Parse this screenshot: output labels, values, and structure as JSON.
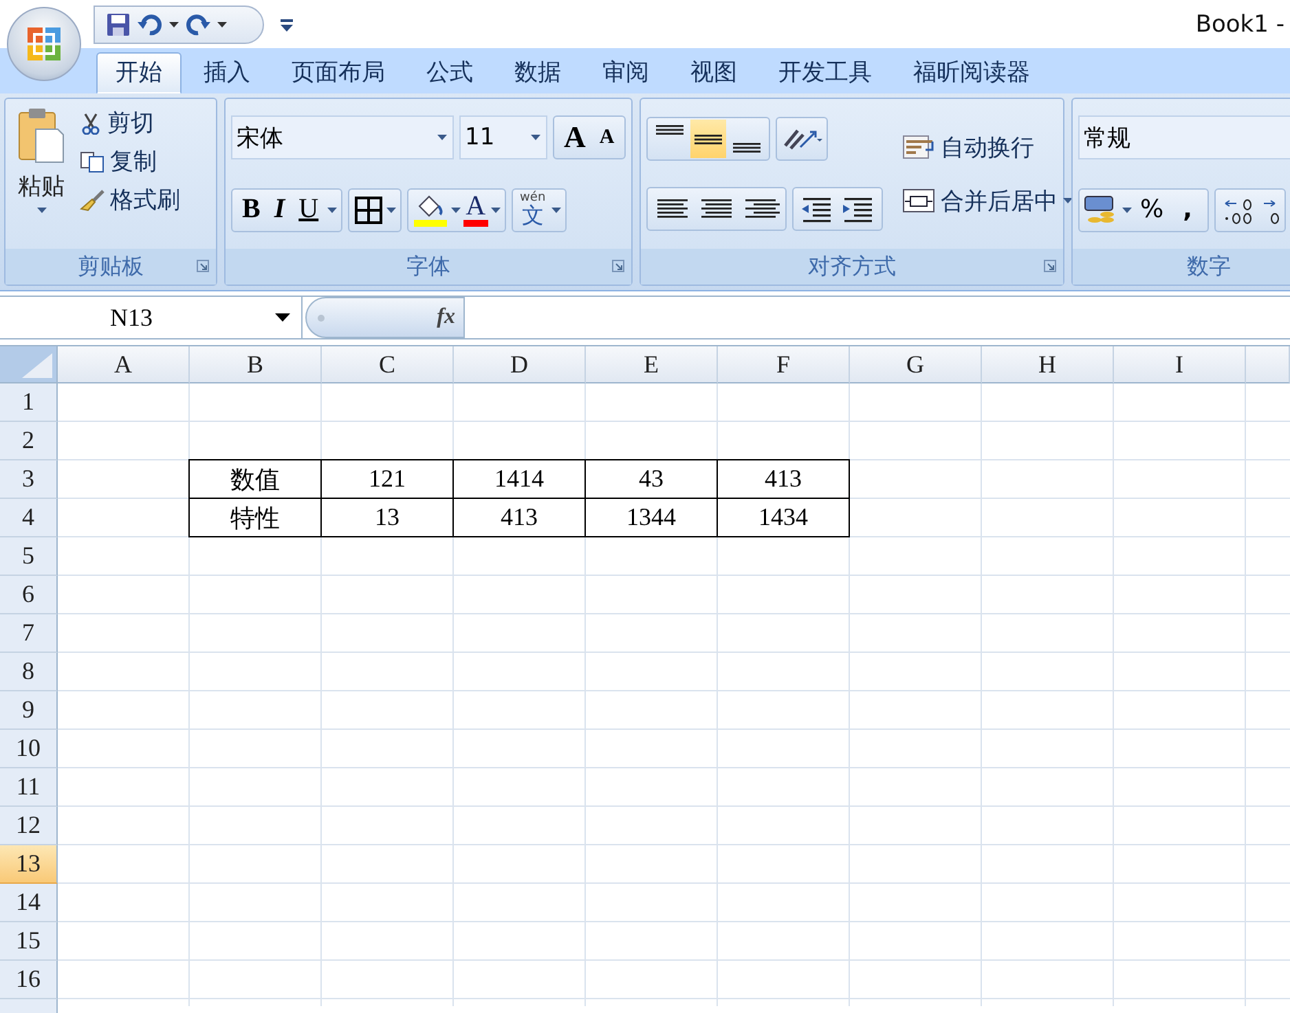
{
  "window": {
    "title": "Book1 -"
  },
  "tabs": [
    {
      "label": "开始",
      "selected": true
    },
    {
      "label": "插入",
      "selected": false
    },
    {
      "label": "页面布局",
      "selected": false
    },
    {
      "label": "公式",
      "selected": false
    },
    {
      "label": "数据",
      "selected": false
    },
    {
      "label": "审阅",
      "selected": false
    },
    {
      "label": "视图",
      "selected": false
    },
    {
      "label": "开发工具",
      "selected": false
    },
    {
      "label": "福昕阅读器",
      "selected": false
    }
  ],
  "ribbon": {
    "clipboard": {
      "label": "剪贴板",
      "paste": "粘贴",
      "items": [
        "剪切",
        "复制",
        "格式刷"
      ]
    },
    "font": {
      "label": "字体",
      "font_name": "宋体",
      "font_size": "11",
      "grow": "A",
      "shrink": "A",
      "styles": [
        "B",
        "I",
        "U"
      ],
      "font_color": "A",
      "phonetic_pinyin": "wén",
      "phonetic_char": "文"
    },
    "alignment": {
      "label": "对齐方式",
      "vertical": [
        {
          "selected": false
        },
        {
          "selected": true
        },
        {
          "selected": false
        }
      ],
      "wrap_text": "自动换行",
      "merge_center": "合并后居中"
    },
    "number": {
      "label": "数字",
      "format": "常规",
      "percent": "%",
      "comma": ","
    }
  },
  "formula_bar": {
    "name_box": "N13",
    "function_label": "fx"
  },
  "sheet": {
    "columns": [
      "A",
      "B",
      "C",
      "D",
      "E",
      "F",
      "G",
      "H",
      "I"
    ],
    "rows": [
      {
        "label": "1",
        "selected": false
      },
      {
        "label": "2",
        "selected": false
      },
      {
        "label": "3",
        "selected": false
      },
      {
        "label": "4",
        "selected": false
      },
      {
        "label": "5",
        "selected": false
      },
      {
        "label": "6",
        "selected": false
      },
      {
        "label": "7",
        "selected": false
      },
      {
        "label": "8",
        "selected": false
      },
      {
        "label": "9",
        "selected": false
      },
      {
        "label": "10",
        "selected": false
      },
      {
        "label": "11",
        "selected": false
      },
      {
        "label": "12",
        "selected": false
      },
      {
        "label": "13",
        "selected": true
      },
      {
        "label": "14",
        "selected": false
      },
      {
        "label": "15",
        "selected": false
      },
      {
        "label": "16",
        "selected": false
      }
    ],
    "table": [
      [
        "数值",
        "121",
        "1414",
        "43",
        "413"
      ],
      [
        "特性",
        "13",
        "413",
        "1344",
        "1434"
      ]
    ]
  }
}
